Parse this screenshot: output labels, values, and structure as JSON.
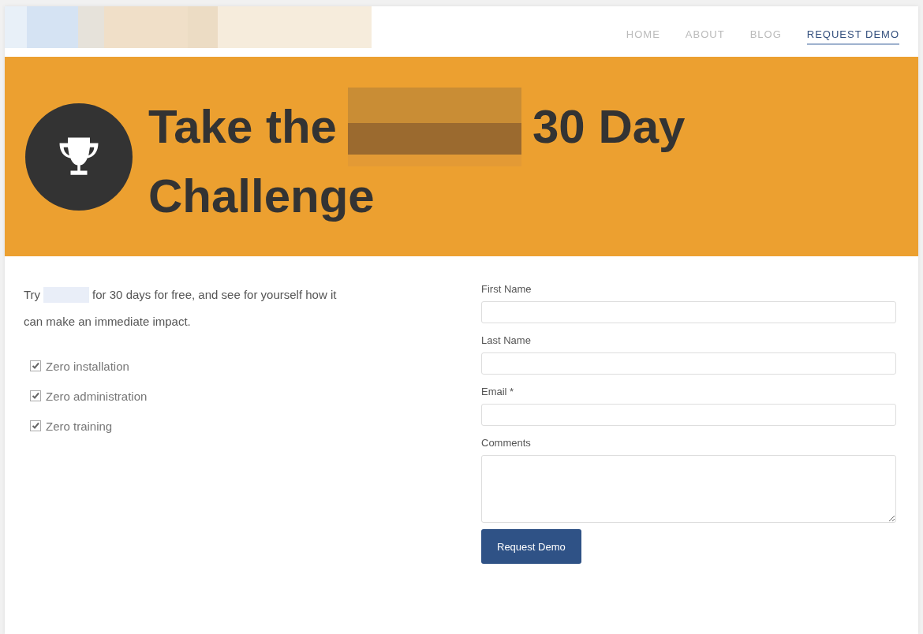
{
  "nav": [
    {
      "label": "HOME",
      "selected": false
    },
    {
      "label": "ABOUT",
      "selected": false
    },
    {
      "label": "BLOG",
      "selected": false
    },
    {
      "label": "REQUEST DEMO",
      "selected": true
    }
  ],
  "banner": {
    "title_before": "Take the",
    "title_after": "30 Day",
    "title_line2": "Challenge"
  },
  "intro": {
    "before": "Try",
    "after": "for 30 days for free, and see for yourself how it",
    "line2": "can make an immediate impact."
  },
  "features": [
    {
      "label": "Zero installation",
      "checked": true
    },
    {
      "label": "Zero administration",
      "checked": true
    },
    {
      "label": "Zero training",
      "checked": true
    }
  ],
  "form": {
    "fields": [
      {
        "label": "First Name",
        "kind": "input"
      },
      {
        "label": "Last Name",
        "kind": "input"
      },
      {
        "label": "Email *",
        "kind": "input"
      },
      {
        "label": "Comments",
        "kind": "textarea"
      }
    ],
    "submit": "Request Demo"
  }
}
